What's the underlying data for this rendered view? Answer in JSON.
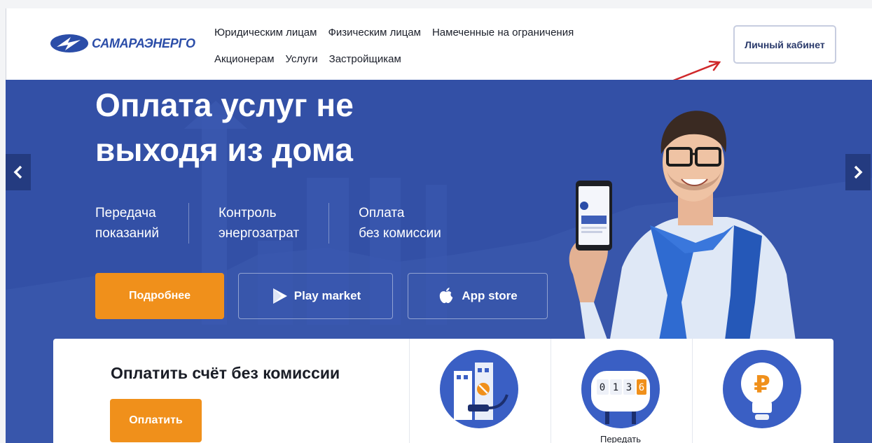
{
  "header": {
    "logo_text": "САМАРАЭНЕРГО",
    "nav_row1": [
      "Юридическим лицам",
      "Физическим лицам",
      "Намеченные на ограничения"
    ],
    "nav_row2": [
      "Акционерам",
      "Услуги",
      "Застройщикам"
    ],
    "account_button": "Личный кабинет"
  },
  "hero": {
    "title_line1": "Оплата услуг не",
    "title_line2": "выходя из дома",
    "features": [
      {
        "line1": "Передача",
        "line2": "показаний"
      },
      {
        "line1": "Контроль",
        "line2": "энергозатрат"
      },
      {
        "line1": "Оплата",
        "line2": "без комиссии"
      }
    ],
    "more_button": "Подробнее",
    "play_button": "Play market",
    "app_button": "App store"
  },
  "services": {
    "pay_title": "Оплатить счёт без комиссии",
    "pay_button": "Оплатить",
    "meter_digits": "0136",
    "items": [
      {
        "label": "",
        "icon": "utilities-icon"
      },
      {
        "label": "Передать",
        "icon": "meter-icon"
      },
      {
        "label": "",
        "icon": "ruble-bulb-icon"
      }
    ]
  },
  "colors": {
    "brand_blue": "#3350a6",
    "accent_orange": "#f0901b",
    "logo_blue": "#2b4da8",
    "annotation_red": "#d0282a"
  }
}
